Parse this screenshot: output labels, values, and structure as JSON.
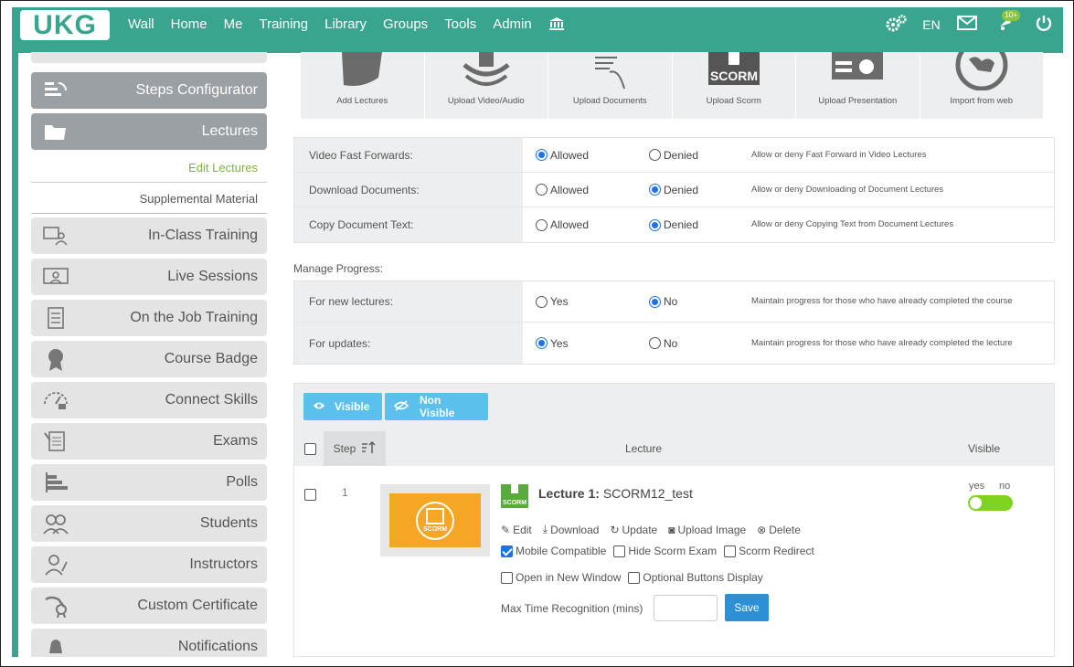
{
  "brand": {
    "logo_text": "UKG",
    "color": "#3aa58e"
  },
  "nav": {
    "items": [
      "Wall",
      "Home",
      "Me",
      "Training",
      "Library",
      "Groups",
      "Tools",
      "Admin"
    ],
    "bank_icon": "bank-icon"
  },
  "top_right": {
    "settings_icon": "gears-icon",
    "lang": "EN",
    "mail_icon": "envelope-icon",
    "notif_icon": "bell-icon",
    "notif_badge": "10+",
    "power_icon": "power-icon"
  },
  "sidebar": {
    "items": [
      {
        "label": "Steps Configurator",
        "icon": "steps-icon",
        "active": true
      },
      {
        "label": "Lectures",
        "icon": "folder-icon",
        "active": true
      },
      {
        "label": "In-Class Training",
        "icon": "classroom-icon"
      },
      {
        "label": "Live Sessions",
        "icon": "presenter-icon"
      },
      {
        "label": "On the Job Training",
        "icon": "checklist-icon"
      },
      {
        "label": "Course Badge",
        "icon": "badge-icon"
      },
      {
        "label": "Connect Skills",
        "icon": "skills-icon"
      },
      {
        "label": "Exams",
        "icon": "exam-icon"
      },
      {
        "label": "Polls",
        "icon": "polls-icon"
      },
      {
        "label": "Students",
        "icon": "students-icon"
      },
      {
        "label": "Instructors",
        "icon": "instructor-icon"
      },
      {
        "label": "Custom Certificate",
        "icon": "certificate-icon"
      },
      {
        "label": "Notifications",
        "icon": "bell-icon"
      }
    ],
    "sub": {
      "edit": "Edit Lectures",
      "supp": "Supplemental Material"
    }
  },
  "uploads": [
    "Add Lectures",
    "Upload Video/Audio",
    "Upload Documents",
    "Upload Scorm",
    "Upload Presentation",
    "Import from web"
  ],
  "scorm_word": "SCORM",
  "settings": [
    {
      "key": "Video Fast Forwards:",
      "opt1": "Allowed",
      "opt2": "Denied",
      "sel": 1,
      "desc": "Allow or deny Fast Forward in Video Lectures"
    },
    {
      "key": "Download Documents:",
      "opt1": "Allowed",
      "opt2": "Denied",
      "sel": 2,
      "desc": "Allow or deny Downloading of Document Lectures"
    },
    {
      "key": "Copy Document Text:",
      "opt1": "Allowed",
      "opt2": "Denied",
      "sel": 2,
      "desc": "Allow or deny Copying Text from Document Lectures"
    }
  ],
  "manage": {
    "title": "Manage Progress:",
    "rows": [
      {
        "key": "For new lectures:",
        "opt1": "Yes",
        "opt2": "No",
        "sel": 2,
        "desc": "Maintain progress for those who have already completed the course"
      },
      {
        "key": "For updates:",
        "opt1": "Yes",
        "opt2": "No",
        "sel": 1,
        "desc": "Maintain progress for those who have already completed the lecture"
      }
    ]
  },
  "panel": {
    "visible_btn": "Visible",
    "nonvisible_btn": "Non Visible",
    "col_step": "Step",
    "col_lecture": "Lecture",
    "col_visible": "Visible",
    "row": {
      "step": "1",
      "title_prefix": "Lecture 1:",
      "title": "SCORM12_test",
      "type_badge": "SCORM",
      "actions": [
        "Edit",
        "Download",
        "Update",
        "Upload Image",
        "Delete"
      ],
      "checks1": [
        {
          "label": "Mobile Compatible",
          "on": true
        },
        {
          "label": "Hide Scorm Exam",
          "on": false
        },
        {
          "label": "Scorm Redirect",
          "on": false
        }
      ],
      "checks2": [
        {
          "label": "Open in New Window",
          "on": false
        },
        {
          "label": "Optional Buttons Display",
          "on": false
        }
      ],
      "max_time_label": "Max Time Recognition (mins)",
      "max_time_value": "",
      "save": "Save",
      "toggle_yes": "yes",
      "toggle_no": "no",
      "visible": true
    }
  }
}
